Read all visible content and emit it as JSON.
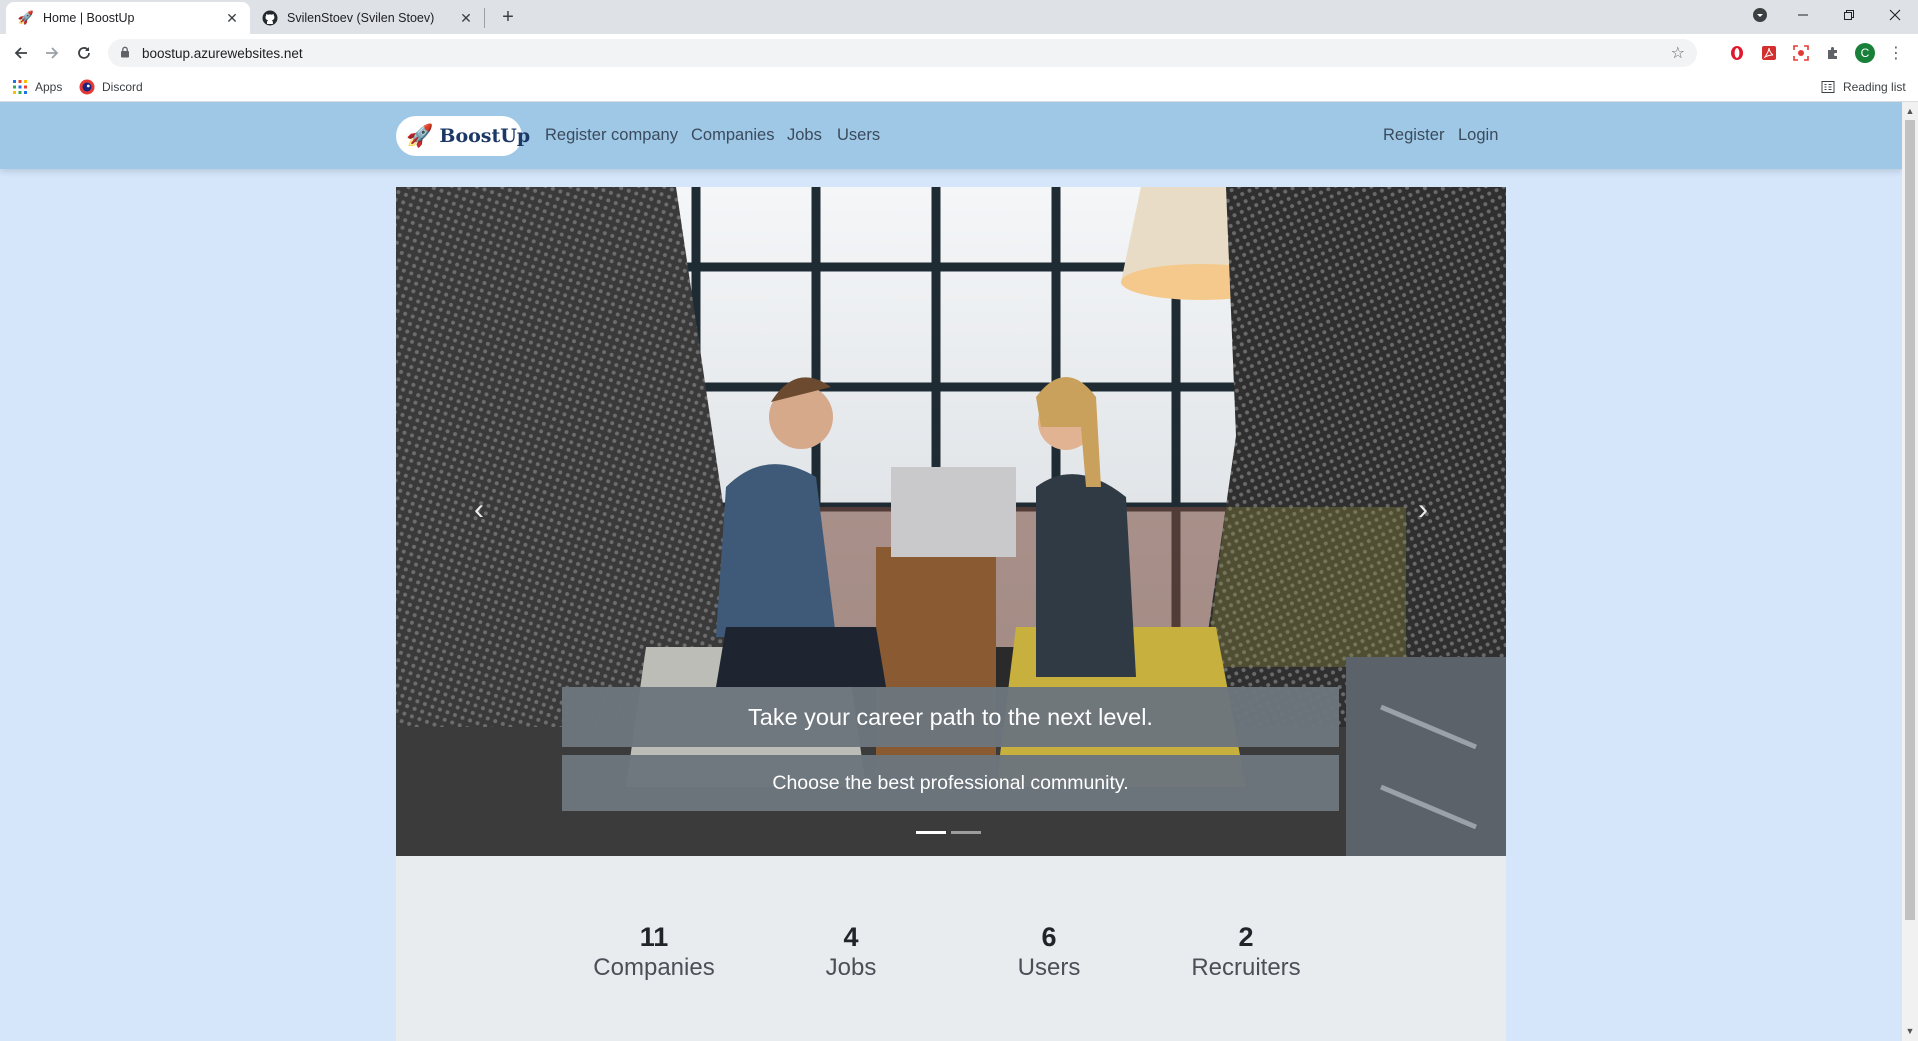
{
  "browser": {
    "tabs": [
      {
        "title": "Home | BoostUp",
        "icon": "rocket-icon",
        "active": true
      },
      {
        "title": "SvilenStoev (Svilen Stoev)",
        "icon": "github-icon",
        "active": false
      }
    ],
    "url": "boostup.azurewebsites.net",
    "bookmarks": [
      {
        "label": "Apps",
        "icon": "apps-grid-icon"
      },
      {
        "label": "Discord",
        "icon": "discord-icon"
      }
    ],
    "reading_list": "Reading list",
    "profile_initial": "C"
  },
  "site": {
    "brand": "BoostUp",
    "nav_left": [
      "Register company",
      "Companies",
      "Jobs",
      "Users"
    ],
    "nav_right": [
      "Register",
      "Login"
    ],
    "carousel": {
      "caption_title": "Take your career path to the next level.",
      "caption_text": "Choose the best professional community.",
      "slide_count": 2,
      "active_slide": 1
    },
    "stats": [
      {
        "value": "11",
        "label": "Companies"
      },
      {
        "value": "4",
        "label": "Jobs"
      },
      {
        "value": "6",
        "label": "Users"
      },
      {
        "value": "2",
        "label": "Recruiters"
      }
    ]
  },
  "colors": {
    "navbar": "#9ec8e6",
    "page_background": "#d5e6fb",
    "caption_background": "#6c757d",
    "stats_background": "#e9ecef"
  }
}
